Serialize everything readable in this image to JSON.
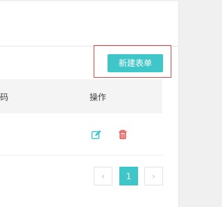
{
  "toolbar": {
    "new_form_label": "新建表单"
  },
  "table": {
    "columns": {
      "code": "码",
      "ops": "操作"
    }
  },
  "actions": {
    "edit_icon": "edit-icon",
    "delete_icon": "trash-icon"
  },
  "pagination": {
    "prev_label": "‹",
    "current_page": "1",
    "next_label": "›"
  },
  "colors": {
    "accent": "#3ec6c9",
    "danger": "#e34d4d",
    "highlight": "#d94b4b"
  }
}
